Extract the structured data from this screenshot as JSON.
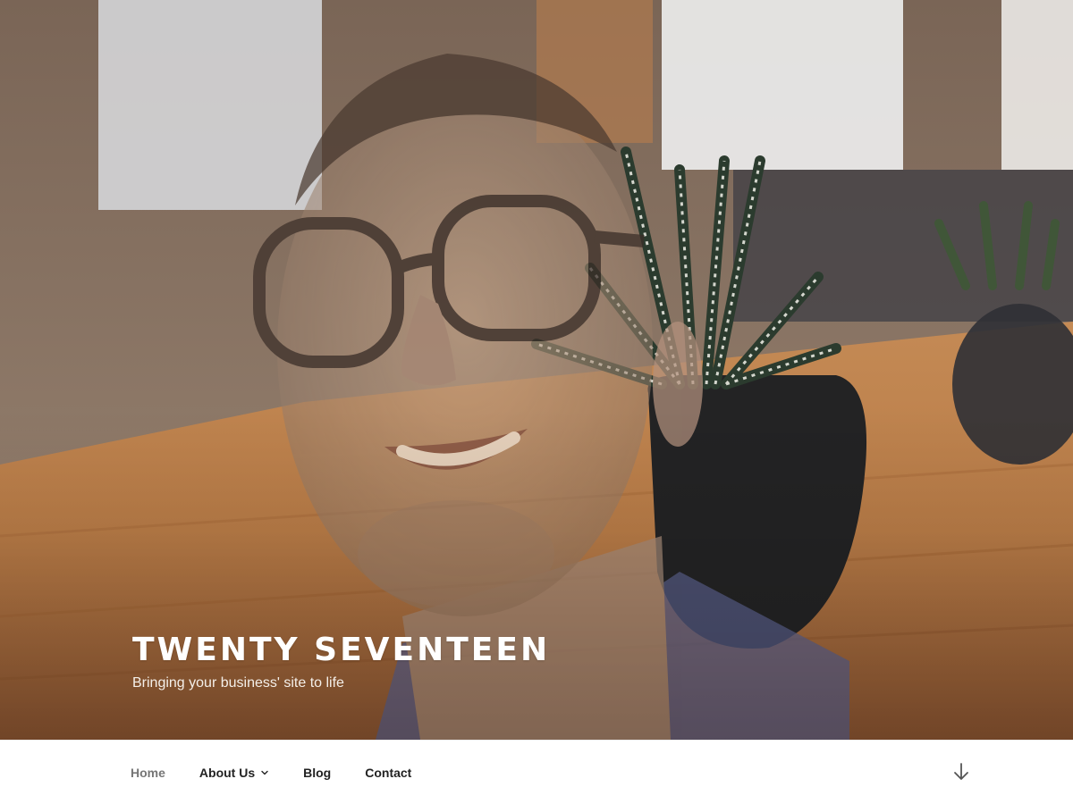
{
  "header": {
    "site_title": "TWENTY SEVENTEEN",
    "tagline": "Bringing your business' site to life"
  },
  "nav": {
    "items": [
      {
        "label": "Home",
        "current": true,
        "has_submenu": false
      },
      {
        "label": "About Us",
        "current": false,
        "has_submenu": true,
        "submenu_icon": "chevron-down-icon"
      },
      {
        "label": "Blog",
        "current": false,
        "has_submenu": false
      },
      {
        "label": "Contact",
        "current": false,
        "has_submenu": false
      }
    ],
    "scroll_icon": "arrow-down-icon"
  },
  "colors": {
    "menu_text": "#222222",
    "menu_current": "#767676",
    "nav_background": "#ffffff",
    "title_text": "#ffffff"
  }
}
